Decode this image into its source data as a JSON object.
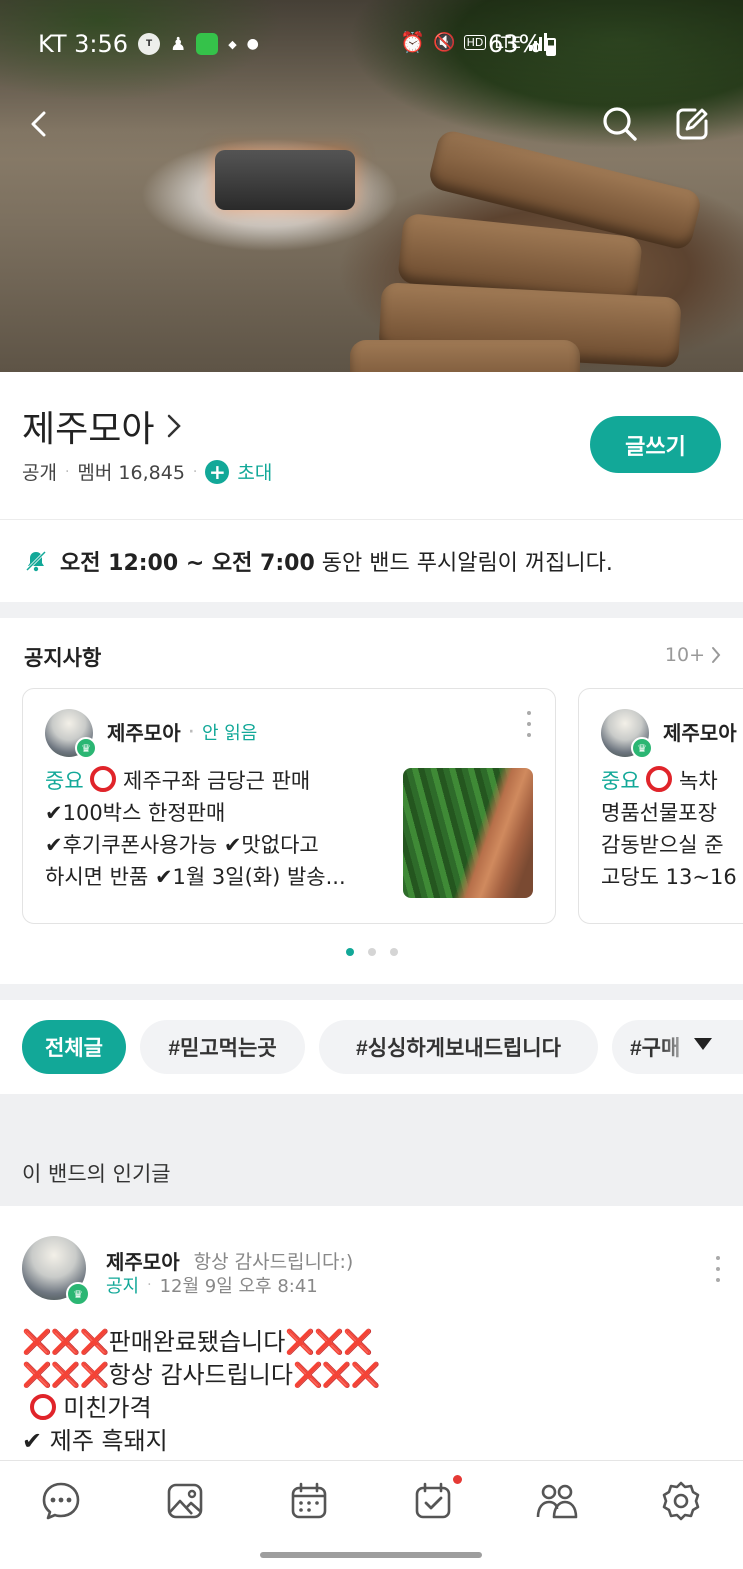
{
  "status_bar": {
    "carrier_time": "KT 3:56",
    "network": "LTE",
    "battery": "63%",
    "icons": [
      "talk-icon",
      "person-icon",
      "app-icon",
      "legend-icon",
      "alarm-icon",
      "mute-icon",
      "hd-icon",
      "signal-icon",
      "battery-icon"
    ]
  },
  "band": {
    "name": "제주모아",
    "visibility": "공개",
    "members_label": "멤버 16,845",
    "invite_label": "초대",
    "write_label": "글쓰기"
  },
  "mute_notice": {
    "bold": "오전 12:00 ~ 오전 7:00",
    "rest": " 동안 밴드 푸시알림이 꺼집니다."
  },
  "notices": {
    "title": "공지사항",
    "more": "10+",
    "cards": [
      {
        "author": "제주모아",
        "unread": "안 읽음",
        "important": "중요",
        "line1": " 제주구좌 금당근 판매",
        "line2": "✔100박스 한정판매",
        "line3": "✔후기쿠폰사용가능 ✔맛없다고",
        "line4": "하시면 반품 ✔1월 3일(화) 발송..."
      },
      {
        "author": "제주모아",
        "important": "중요",
        "line1": " 녹차 ",
        "line2": "명품선물포장 ",
        "line3": "감동받으실 준",
        "line4": "고당도 13~16"
      }
    ],
    "pages": 3,
    "current_page": 1
  },
  "tags": [
    "전체글",
    "#믿고먹는곳",
    "#싱싱하게보내드립니다",
    "#구매"
  ],
  "popular": {
    "title": "이 밴드의 인기글"
  },
  "post": {
    "author": "제주모아",
    "subtitle": "항상 감사드립니다:)",
    "category": "공지",
    "time": "12월 9일 오후 8:41",
    "line1_x": "❌❌❌",
    "line1_text": "판매완료됐습니다",
    "line2_text": "항상 감사드립니다",
    "line3_text": " 미친가격",
    "line4_text": "✔ 제주 흑돼지"
  },
  "bottom_nav": [
    "chat-icon",
    "photo-icon",
    "calendar-icon",
    "mission-icon",
    "members-icon",
    "settings-icon"
  ],
  "colors": {
    "accent": "#12a898",
    "red": "#e0242a"
  }
}
